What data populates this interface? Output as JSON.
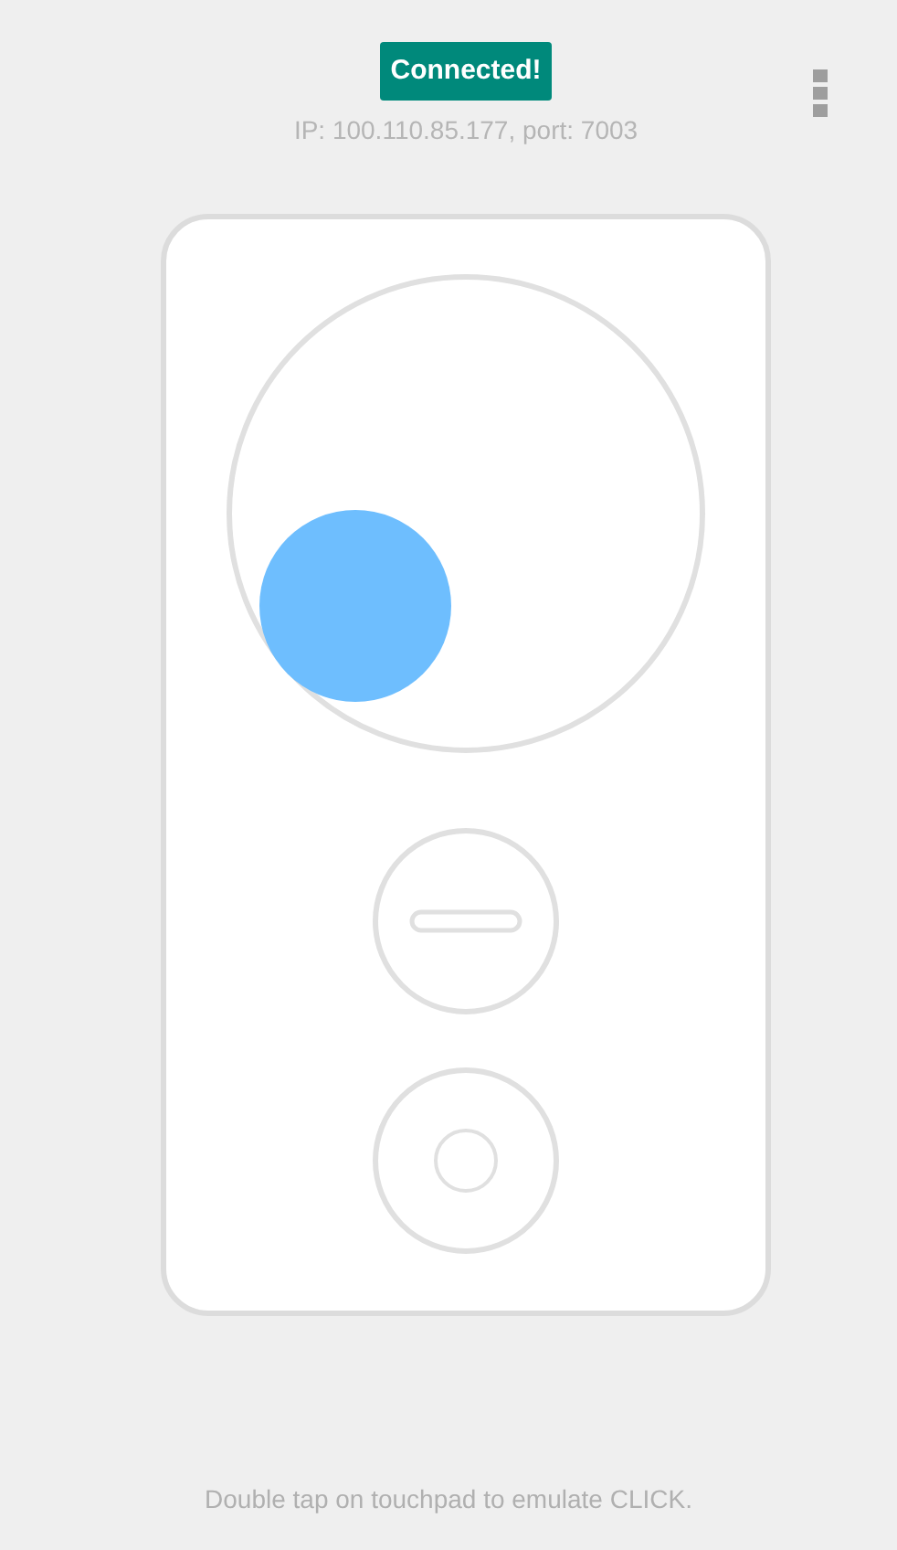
{
  "status": {
    "badge": "Connected!",
    "address": "IP: 100.110.85.177, port: 7003"
  },
  "hint": "Double tap on touchpad to emulate CLICK."
}
